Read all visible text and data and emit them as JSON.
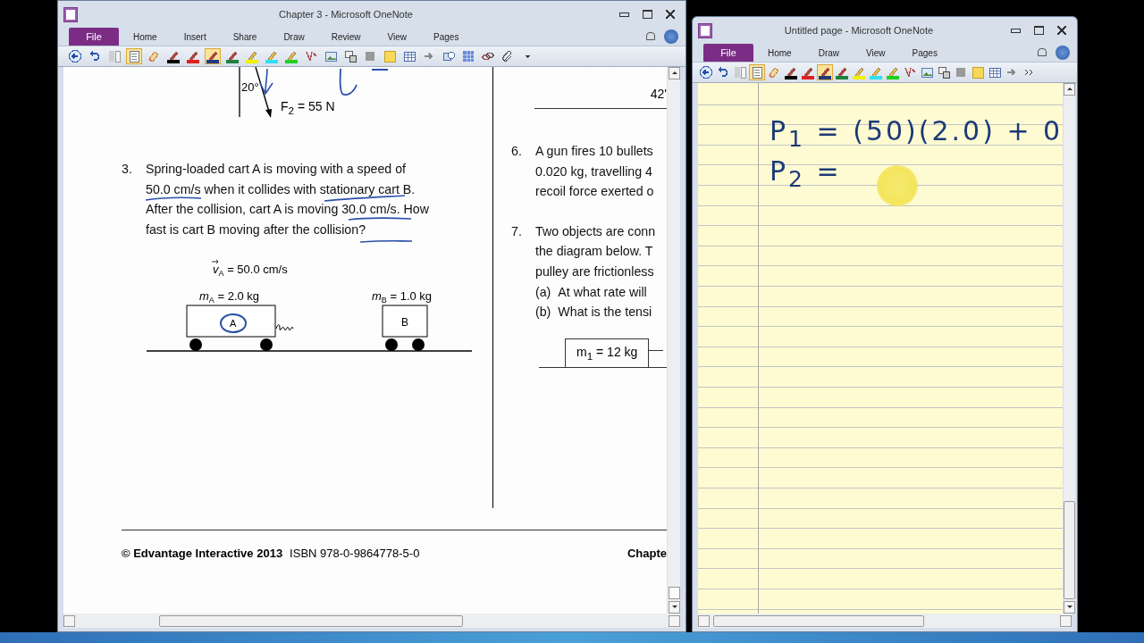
{
  "left_window": {
    "title": "Chapter 3  -  Microsoft OneNote",
    "tabs": [
      {
        "label": "File",
        "kind": "file"
      },
      {
        "label": "Home",
        "kind": "tab"
      },
      {
        "label": "Insert",
        "kind": "tab"
      },
      {
        "label": "Share",
        "kind": "tab"
      },
      {
        "label": "Draw",
        "kind": "tab"
      },
      {
        "label": "Review",
        "kind": "tab"
      },
      {
        "label": "View",
        "kind": "tab"
      },
      {
        "label": "Pages",
        "kind": "tab"
      }
    ],
    "toolbar": [
      {
        "kind": "back",
        "selected": false
      },
      {
        "kind": "undo",
        "selected": false
      },
      {
        "kind": "dock",
        "selected": false
      },
      {
        "kind": "page",
        "selected": true
      },
      {
        "kind": "eraser",
        "selected": false
      },
      {
        "kind": "pen",
        "color": "#000000",
        "selected": false
      },
      {
        "kind": "pen",
        "color": "#e02020",
        "selected": false
      },
      {
        "kind": "pen",
        "color": "#203a80",
        "selected": true
      },
      {
        "kind": "pen",
        "color": "#208040",
        "selected": false
      },
      {
        "kind": "highlighter",
        "color": "#f0f000",
        "selected": false
      },
      {
        "kind": "highlighter",
        "color": "#30e0f0",
        "selected": false
      },
      {
        "kind": "highlighter",
        "color": "#20d020",
        "selected": false
      },
      {
        "kind": "pen-menu",
        "selected": false
      },
      {
        "kind": "picture",
        "selected": false
      },
      {
        "kind": "clip",
        "selected": false
      },
      {
        "kind": "grey",
        "selected": false
      },
      {
        "kind": "note",
        "selected": false
      },
      {
        "kind": "table",
        "selected": false
      },
      {
        "kind": "arrow",
        "selected": false
      },
      {
        "kind": "shapes",
        "selected": false
      },
      {
        "kind": "grid",
        "selected": false
      },
      {
        "kind": "link",
        "selected": false
      },
      {
        "kind": "attach",
        "selected": false
      },
      {
        "kind": "caret",
        "selected": false
      }
    ],
    "document": {
      "top_fragment": {
        "angle": "20°",
        "force": "F$_{2}$ = 55 N",
        "right_angle": "42'"
      },
      "question_3": {
        "number": "3.",
        "lines": [
          "Spring-loaded cart A is moving with a speed of",
          "50.0 cm/s when it collides with stationary cart B.",
          "After the collision, cart A is moving 30.0 cm/s. How",
          "fast is cart B moving after the collision?"
        ],
        "diagram": {
          "velocity": "v$_{A}$ = 50.0 cm/s",
          "mass_a": "m$_{A}$ = 2.0 kg",
          "mass_b": "m$_{B}$ = 1.0 kg",
          "cart_a": "A",
          "cart_b": "B"
        }
      },
      "question_6": {
        "number": "6.",
        "lines": [
          "A gun fires 10 bullets",
          "0.020 kg, travelling 4",
          "recoil force exerted o"
        ]
      },
      "question_7": {
        "number": "7.",
        "lines": [
          "Two objects are conn",
          "the diagram below. T",
          "pulley are frictionless"
        ],
        "parts": [
          {
            "label": "(a)",
            "text": "At what rate will"
          },
          {
            "label": "(b)",
            "text": "What is the tensi"
          }
        ],
        "mass": "m$_{1}$ = 12 kg"
      },
      "footer": {
        "copyright": "© Edvantage Interactive 2013",
        "isbn": "ISBN 978-0-9864778-5-0",
        "chapter": "Chapte"
      }
    }
  },
  "right_window": {
    "title": "Untitled page  -  Microsoft OneNote",
    "tabs": [
      {
        "label": "File",
        "kind": "file"
      },
      {
        "label": "Home",
        "kind": "tab"
      },
      {
        "label": "Draw",
        "kind": "tab"
      },
      {
        "label": "View",
        "kind": "tab"
      },
      {
        "label": "Pages",
        "kind": "tab"
      }
    ],
    "toolbar": [
      {
        "kind": "back",
        "selected": false
      },
      {
        "kind": "undo",
        "selected": false
      },
      {
        "kind": "dock",
        "selected": false
      },
      {
        "kind": "page",
        "selected": true
      },
      {
        "kind": "eraser",
        "selected": false
      },
      {
        "kind": "pen",
        "color": "#000000",
        "selected": false
      },
      {
        "kind": "pen",
        "color": "#e02020",
        "selected": false
      },
      {
        "kind": "pen",
        "color": "#203a80",
        "selected": true
      },
      {
        "kind": "pen",
        "color": "#208040",
        "selected": false
      },
      {
        "kind": "highlighter",
        "color": "#f0f000",
        "selected": false
      },
      {
        "kind": "highlighter",
        "color": "#30e0f0",
        "selected": false
      },
      {
        "kind": "highlighter",
        "color": "#20d020",
        "selected": false
      },
      {
        "kind": "pen-menu",
        "selected": false
      },
      {
        "kind": "picture",
        "selected": false
      },
      {
        "kind": "clip",
        "selected": false
      },
      {
        "kind": "grey",
        "selected": false
      },
      {
        "kind": "note",
        "selected": false
      },
      {
        "kind": "table",
        "selected": false
      },
      {
        "kind": "arrow",
        "selected": false
      },
      {
        "kind": "more",
        "selected": false
      }
    ],
    "ink_lines": [
      "P$_{1}$ = (50)(2.0) + 0",
      "P$_{2}$ ="
    ]
  }
}
